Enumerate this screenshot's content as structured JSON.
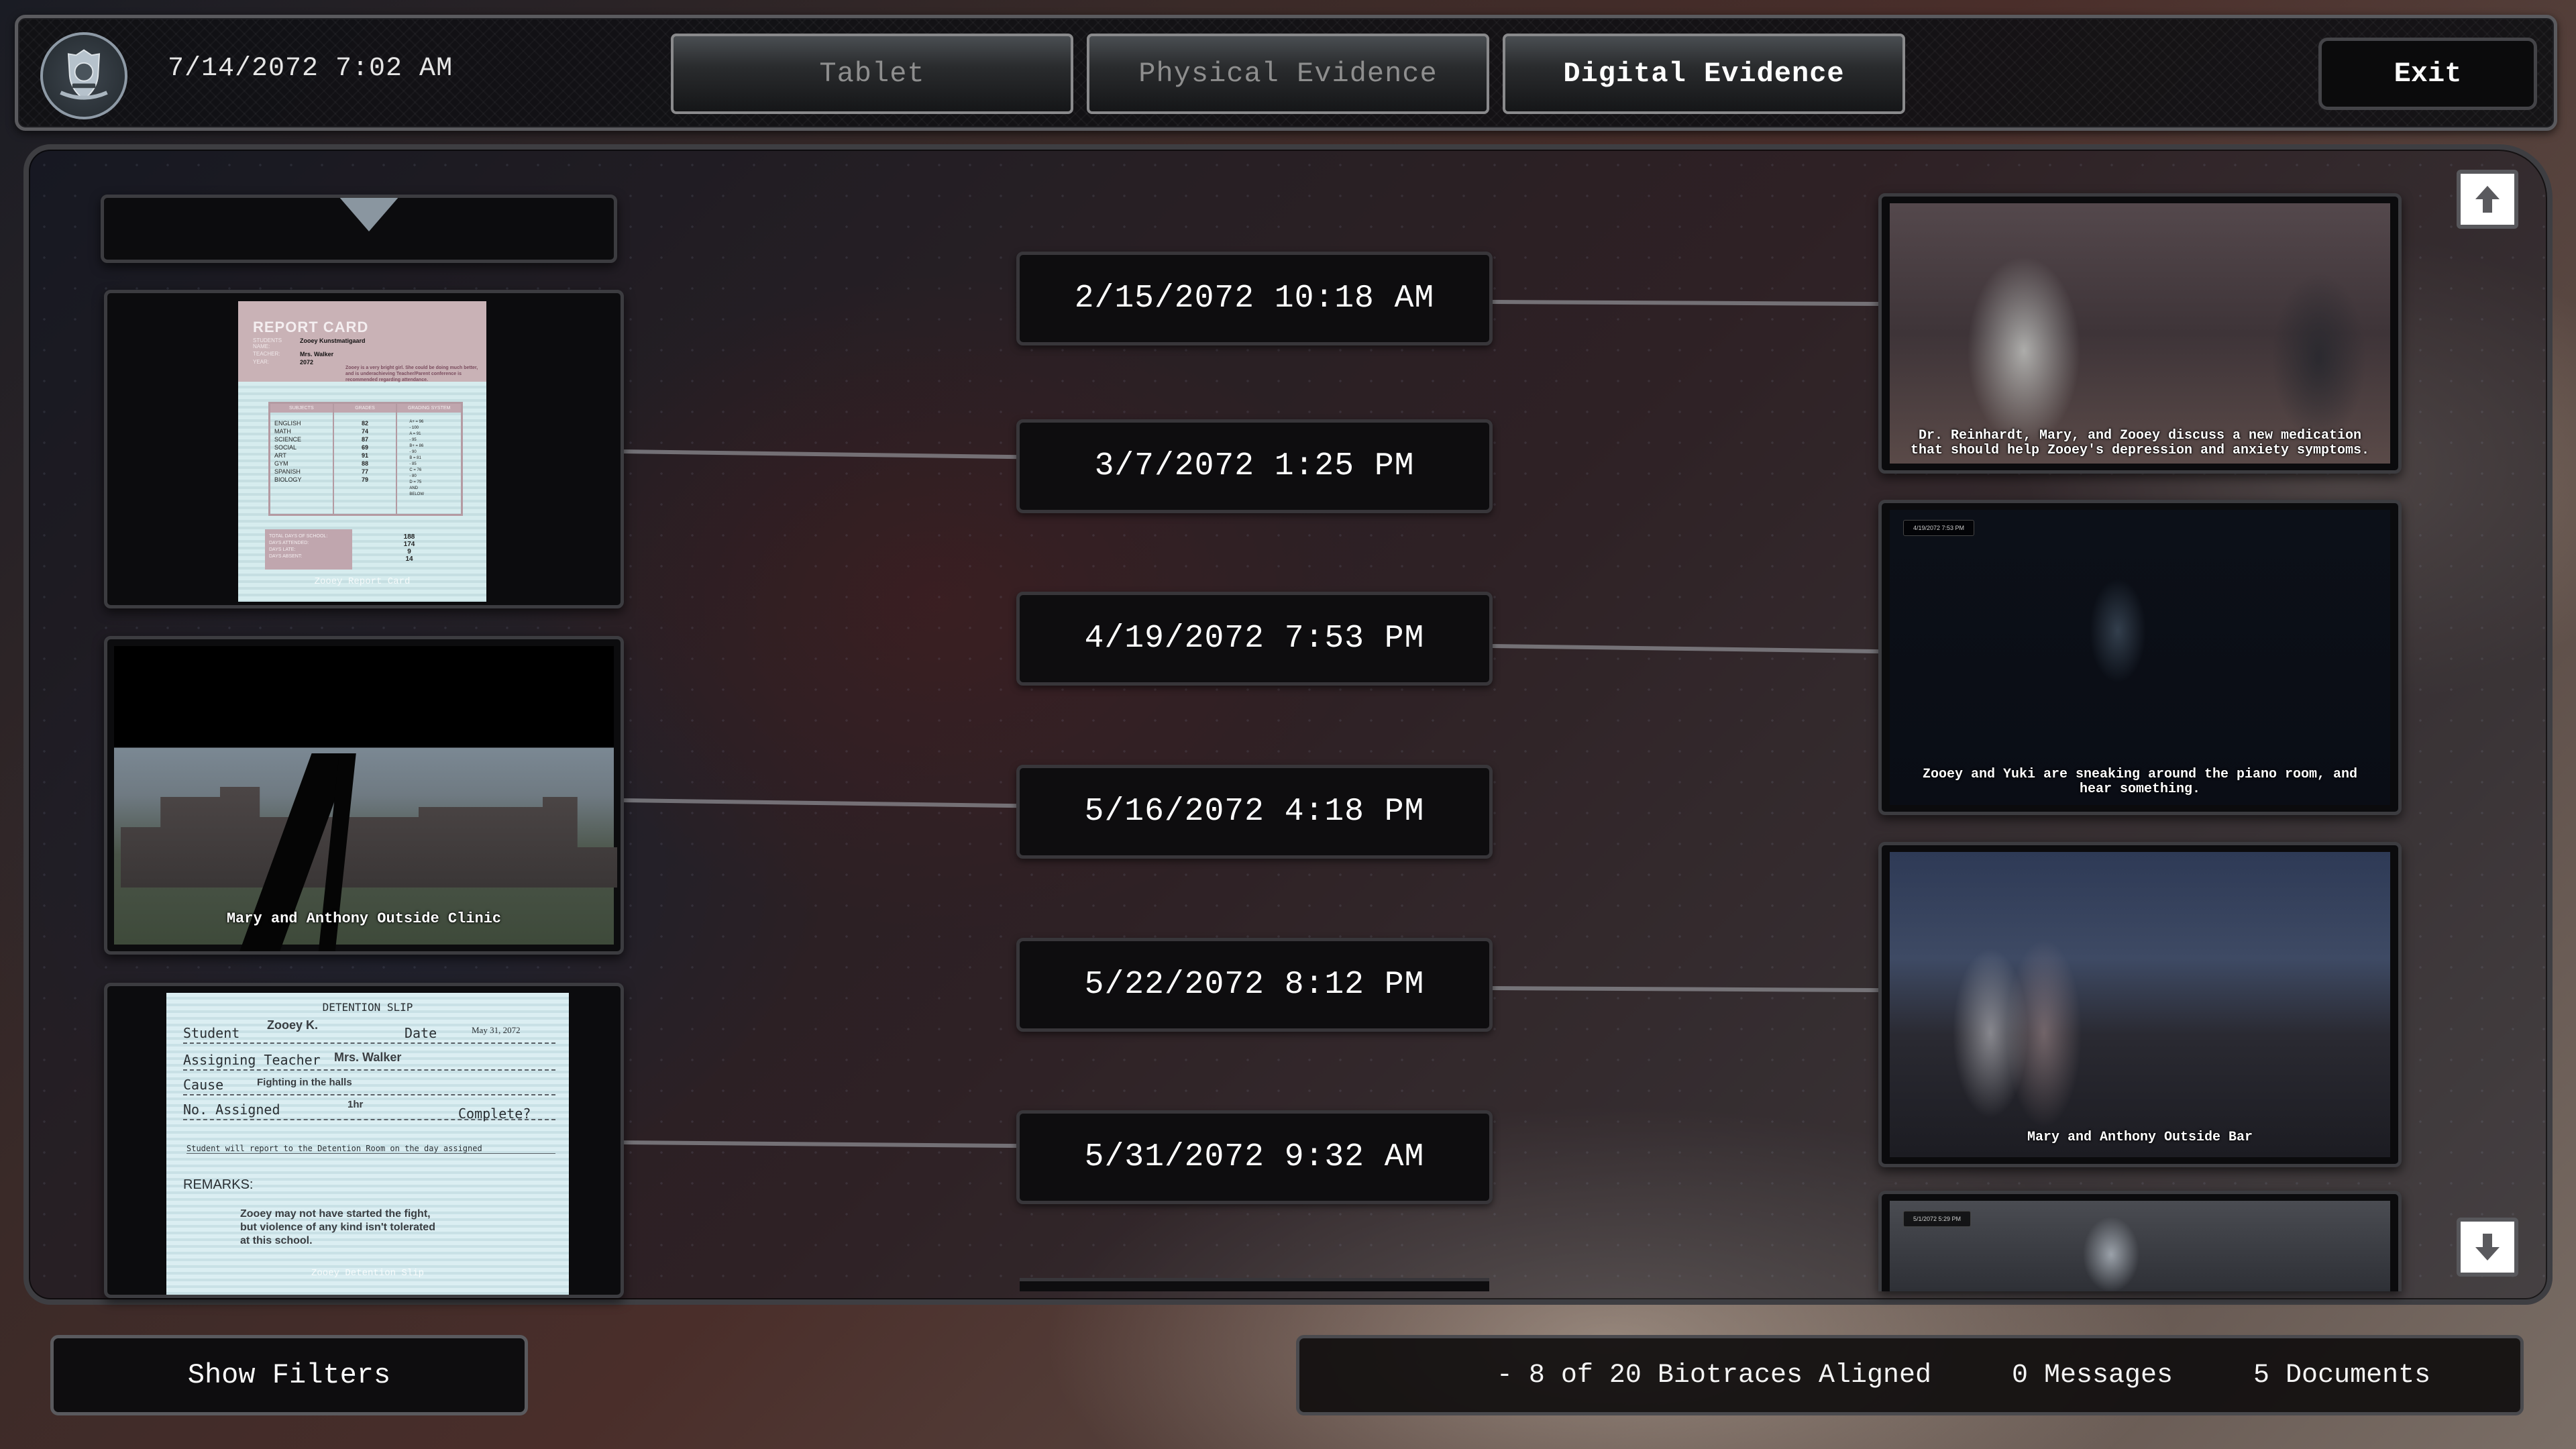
{
  "header": {
    "current_datetime": "7/14/2072 7:02 AM",
    "logo_icon": "special-agent-badge-icon",
    "tabs": [
      {
        "label": "Tablet",
        "active": false
      },
      {
        "label": "Physical Evidence",
        "active": false
      },
      {
        "label": "Digital Evidence",
        "active": true
      }
    ],
    "exit_label": "Exit"
  },
  "colors": {
    "panel_bg": "#0e0d0f",
    "panel_border": "#3c3c40",
    "text_primary": "#ffffff",
    "tab_inactive_text": "#8e8e8e",
    "scroll_button_bg": "#ffffff"
  },
  "timeline": {
    "timestamps": [
      "2/15/2072 10:18 AM",
      "3/7/2072 1:25 PM",
      "4/19/2072 7:53 PM",
      "5/16/2072 4:18 PM",
      "5/22/2072 8:12 PM",
      "5/31/2072 9:32 AM"
    ]
  },
  "left_evidence": {
    "report_card": {
      "title": "REPORT CARD",
      "fields": [
        {
          "label": "STUDENTS NAME:",
          "value": "Zooey Kunstmatigaard"
        },
        {
          "label": "TEACHER:",
          "value": "Mrs. Walker"
        },
        {
          "label": "YEAR:",
          "value": "2072"
        }
      ],
      "comment": "Zooey is a very bright girl. She could be doing much better, and is underachieving Teacher/Parent conference is recommended regarding attendance.",
      "table_headers": [
        "SUBJECTS",
        "GRADES",
        "GRADING SYSTEM"
      ],
      "subjects": [
        "ENGLISH",
        "MATH",
        "SCIENCE",
        "SOCIAL",
        "ART",
        "GYM",
        "SPANISH",
        "BIOLOGY"
      ],
      "grades": [
        "82",
        "74",
        "87",
        "69",
        "91",
        "88",
        "77",
        "79"
      ],
      "grading_system": [
        "A+ = 96",
        "- 100",
        "A = 91",
        "- 95",
        "B+ = 86",
        "- 90",
        "B = 81",
        "- 85",
        "C = 76",
        "- 80",
        "D = 75",
        "AND",
        "BELOW"
      ],
      "attendance_labels": [
        "TOTAL DAYS OF SCHOOL:",
        "DAYS ATTENDED:",
        "DAYS LATE:",
        "DAYS ABSENT:"
      ],
      "attendance_values": [
        "188",
        "174",
        "9",
        "14"
      ],
      "caption": "Zooey Report Card"
    },
    "clinic_photo": {
      "caption": "Mary and Anthony Outside Clinic"
    },
    "detention_slip": {
      "title": "DETENTION SLIP",
      "student_label": "Student",
      "student_value": "Zooey K.",
      "date_label": "Date",
      "date_value": "May 31, 2072",
      "teacher_label": "Assigning Teacher",
      "teacher_value": "Mrs. Walker",
      "cause_label": "Cause",
      "cause_value": "Fighting in the halls",
      "assigned_label": "No. Assigned",
      "assigned_value": "1hr",
      "complete_label": "Complete?",
      "notice": "Student will report to the Detention Room on the day assigned",
      "remarks_label": "REMARKS:",
      "remarks": "Zooey may not have started the fight, but violence of any kind isn't tolerated at this school.",
      "caption": "Zooey Detention Slip"
    }
  },
  "right_media": [
    {
      "caption": "Dr. Reinhardt, Mary, and Zooey discuss a new medication that should help Zooey's depression and anxiety symptoms.",
      "timestamp_chip": ""
    },
    {
      "caption": "Zooey and Yuki are sneaking around the piano room, and hear something.",
      "timestamp_chip": "4/19/2072 7:53 PM"
    },
    {
      "caption": "Mary and Anthony Outside Bar",
      "timestamp_chip": ""
    },
    {
      "caption": "",
      "timestamp_chip": "5/1/2072 5:29 PM"
    }
  ],
  "scroll": {
    "up_icon": "arrow-up-icon",
    "down_icon": "arrow-down-icon"
  },
  "footer": {
    "show_filters_label": "Show Filters",
    "biotraces": "- 8 of 20 Biotraces Aligned",
    "messages": "0 Messages",
    "documents": "5 Documents"
  }
}
